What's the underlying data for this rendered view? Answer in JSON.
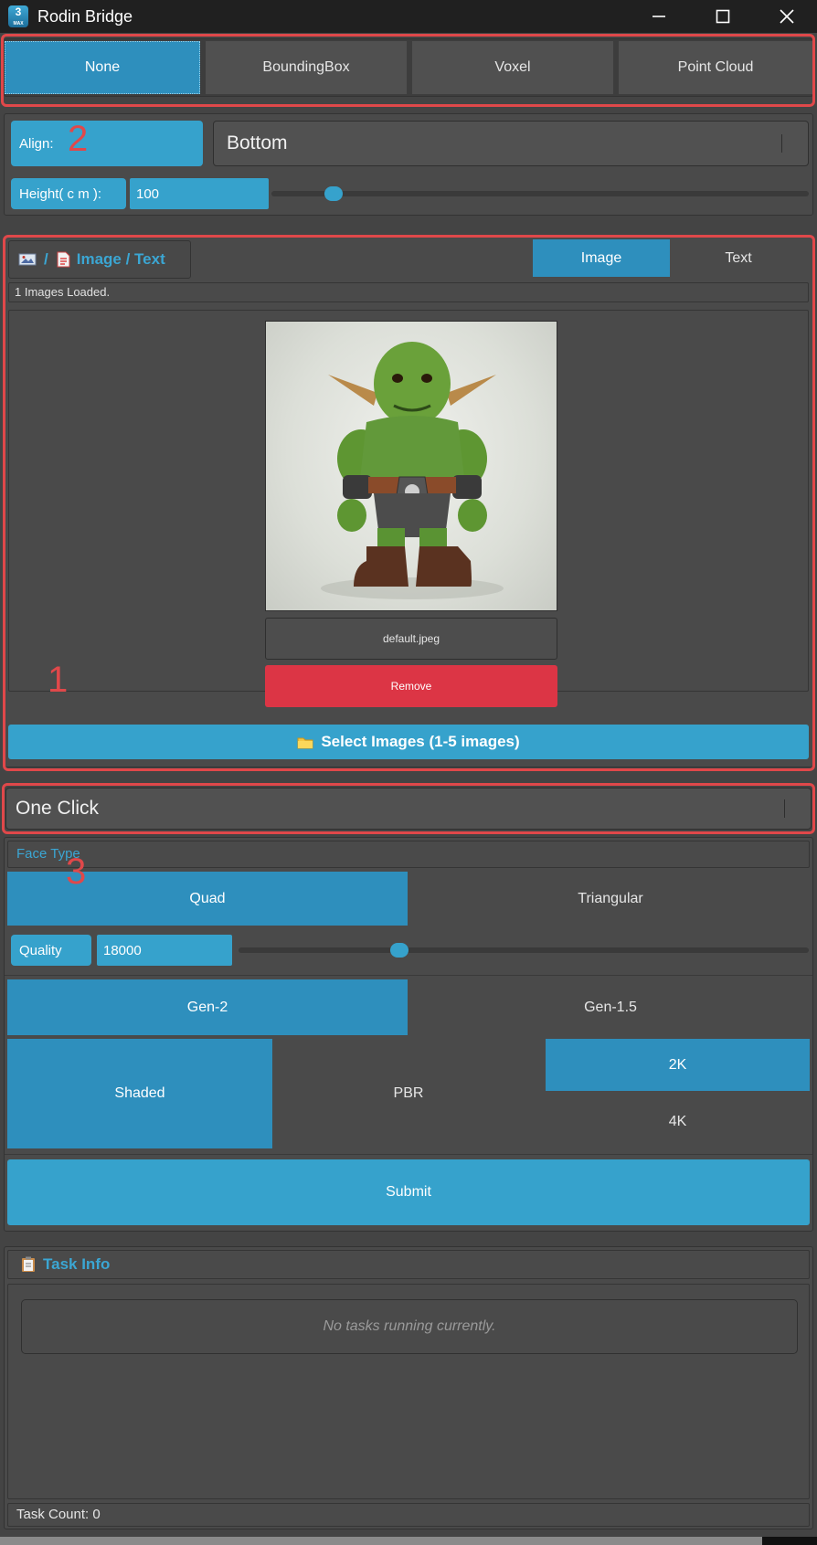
{
  "window": {
    "title": "Rodin Bridge",
    "icon_text": "3",
    "icon_sub": "MAX"
  },
  "bbox_tabs": [
    "None",
    "BoundingBox",
    "Voxel",
    "Point Cloud"
  ],
  "align": {
    "label": "Align:",
    "value": "Bottom"
  },
  "height": {
    "label": "Height( c m ):",
    "value": "100",
    "slider_fraction": 0.11
  },
  "input_section": {
    "header": "Image / Text",
    "separator": "/",
    "mode_tabs": [
      "Image",
      "Text"
    ],
    "status": "1 Images Loaded.",
    "filename": "default.jpeg",
    "remove_label": "Remove",
    "select_label": "Select Images (1-5 images)"
  },
  "mode_dropdown": {
    "value": "One Click"
  },
  "face_type": {
    "label": "Face Type",
    "options": [
      "Quad",
      "Triangular"
    ]
  },
  "quality": {
    "label": "Quality",
    "value": "18000",
    "slider_fraction": 0.28
  },
  "generation": {
    "options": [
      "Gen-2",
      "Gen-1.5"
    ]
  },
  "material": {
    "options": [
      "Shaded",
      "PBR"
    ]
  },
  "resolution": {
    "options": [
      "2K",
      "4K"
    ]
  },
  "submit_label": "Submit",
  "task_info": {
    "header": "Task Info",
    "empty_text": "No tasks running currently.",
    "count_text": "Task Count: 0"
  },
  "annotations": [
    "1",
    "2",
    "3"
  ],
  "colors": {
    "accent": "#36a2cc",
    "accent_dark": "#2e8fbd",
    "danger": "#dc3545",
    "annotation": "#e0484a"
  },
  "icons": [
    "window-minimize-icon",
    "window-maximize-icon",
    "window-close-icon",
    "image-icon",
    "document-icon",
    "folder-icon",
    "clipboard-icon"
  ]
}
